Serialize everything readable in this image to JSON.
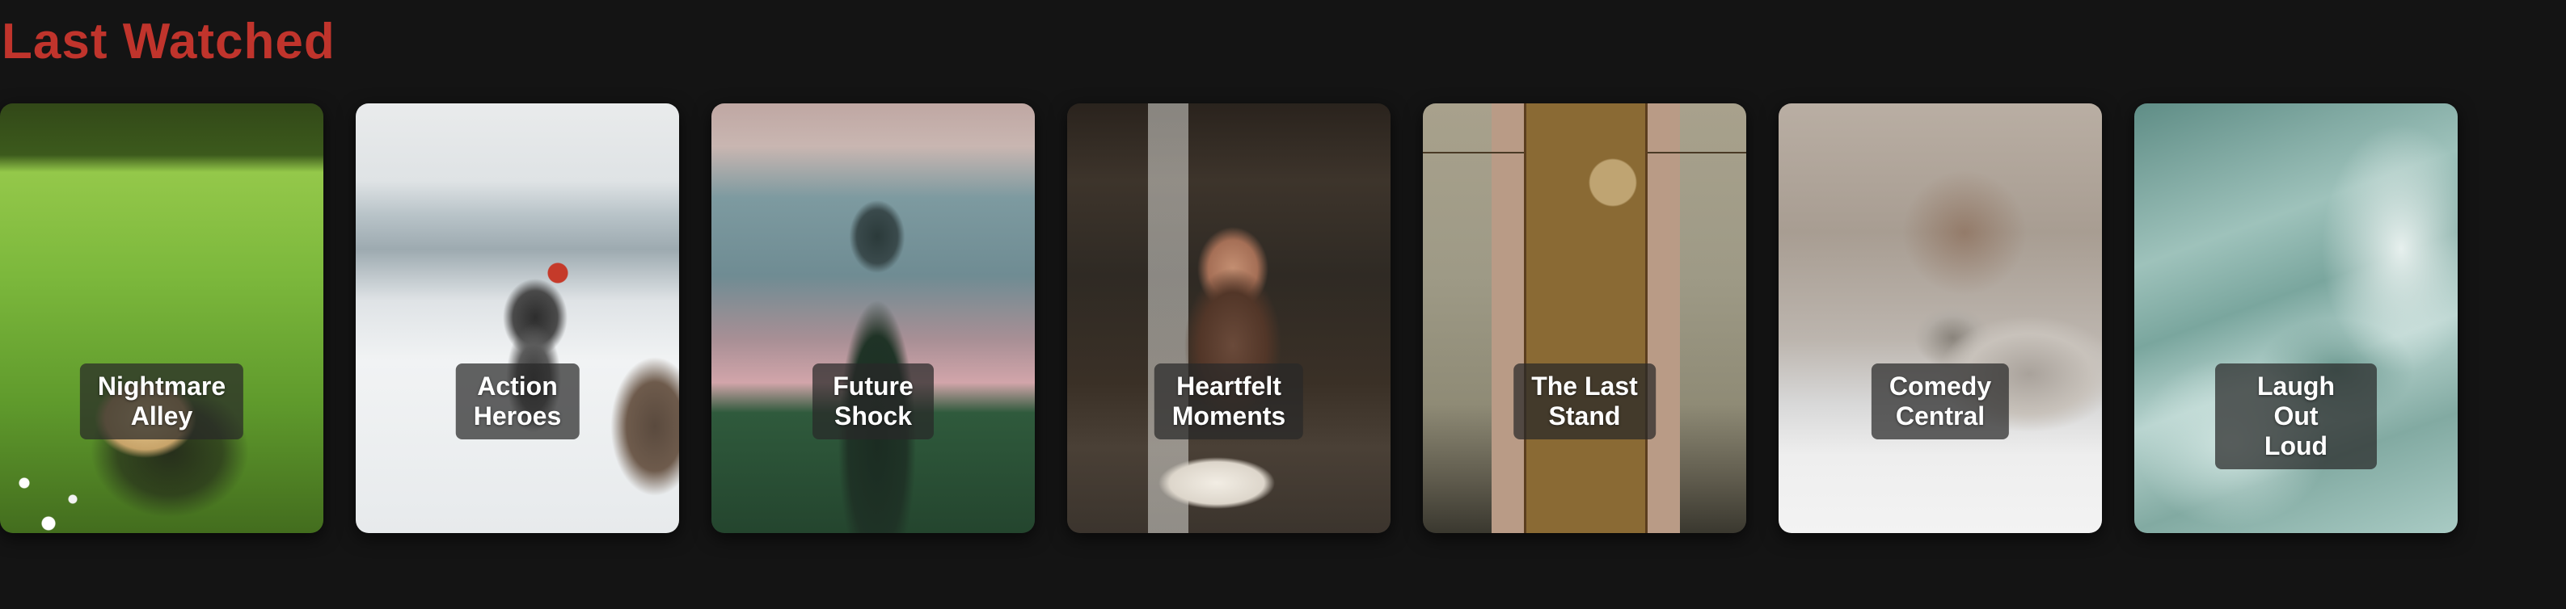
{
  "section": {
    "title": "Last Watched",
    "title_color": "#c0342c",
    "background_color": "#141414"
  },
  "cards": [
    {
      "title": "Nightmare\nAlley"
    },
    {
      "title": "Action\nHeroes"
    },
    {
      "title": "Future\nShock"
    },
    {
      "title": "Heartfelt\nMoments"
    },
    {
      "title": "The Last\nStand"
    },
    {
      "title": "Comedy\nCentral"
    },
    {
      "title": "Laugh Out\nLoud"
    }
  ]
}
